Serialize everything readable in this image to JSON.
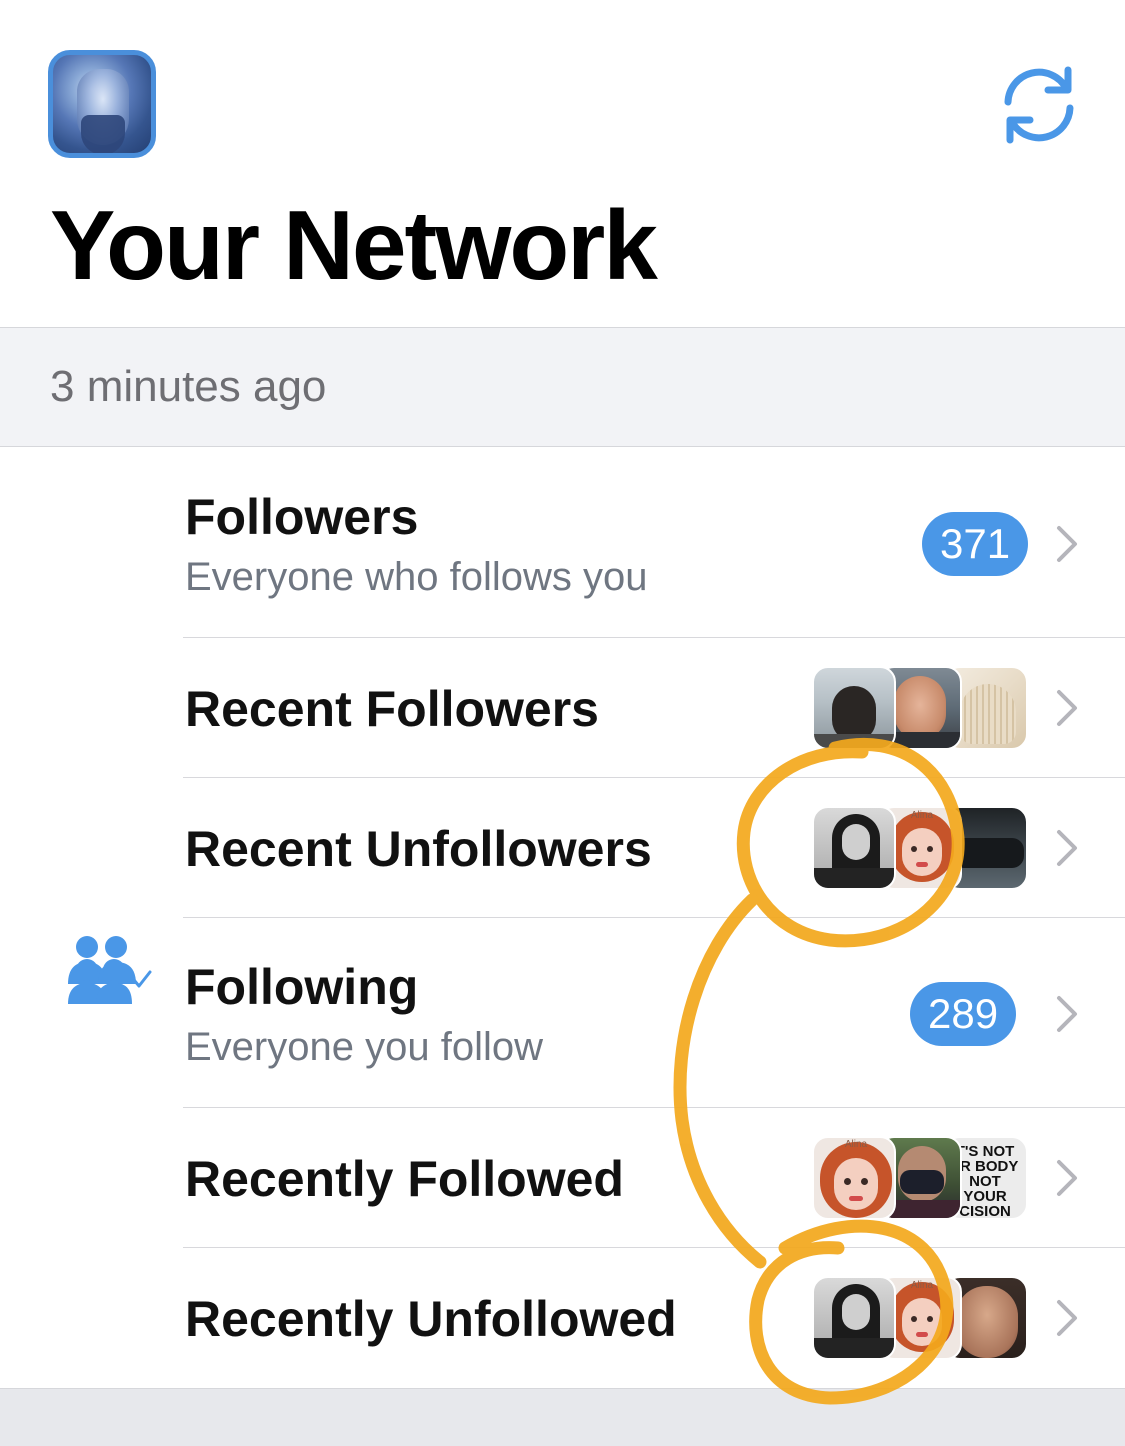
{
  "header": {
    "title": "Your Network",
    "avatar_icon": "profile-avatar",
    "refresh_icon": "refresh-icon",
    "accent_color": "#4a97e7"
  },
  "status": {
    "timestamp": "3 minutes ago"
  },
  "rows": [
    {
      "title": "Followers",
      "subtitle": "Everyone who follows you",
      "count": "371",
      "icon": "followers-icon"
    },
    {
      "title": "Recent Followers",
      "thumbs": [
        "dark-selfie-thumb",
        "smiling-man-thumb",
        "knit-bag-thumb"
      ]
    },
    {
      "title": "Recent Unfollowers",
      "thumbs": [
        "bw-longhair-man-thumb",
        "cartoon-redhead-thumb",
        "dark-scene-thumb"
      ]
    },
    {
      "title": "Following",
      "subtitle": "Everyone you follow",
      "count": "289",
      "icon": "following-icon"
    },
    {
      "title": "Recently Followed",
      "thumbs": [
        "cartoon-redhead-thumb",
        "masked-person-thumb",
        "text-sign-thumb"
      ],
      "thumb_text": "T'S NOT JR BODY NOT YOUR CISION"
    },
    {
      "title": "Recently Unfollowed",
      "thumbs": [
        "bw-longhair-man-thumb",
        "cartoon-redhead-thumb",
        "bald-man-thumb"
      ]
    }
  ],
  "thumb_caption": "Alina",
  "annotation": {
    "color": "#f3a81c",
    "description_icon": "hand-drawn-circles"
  }
}
